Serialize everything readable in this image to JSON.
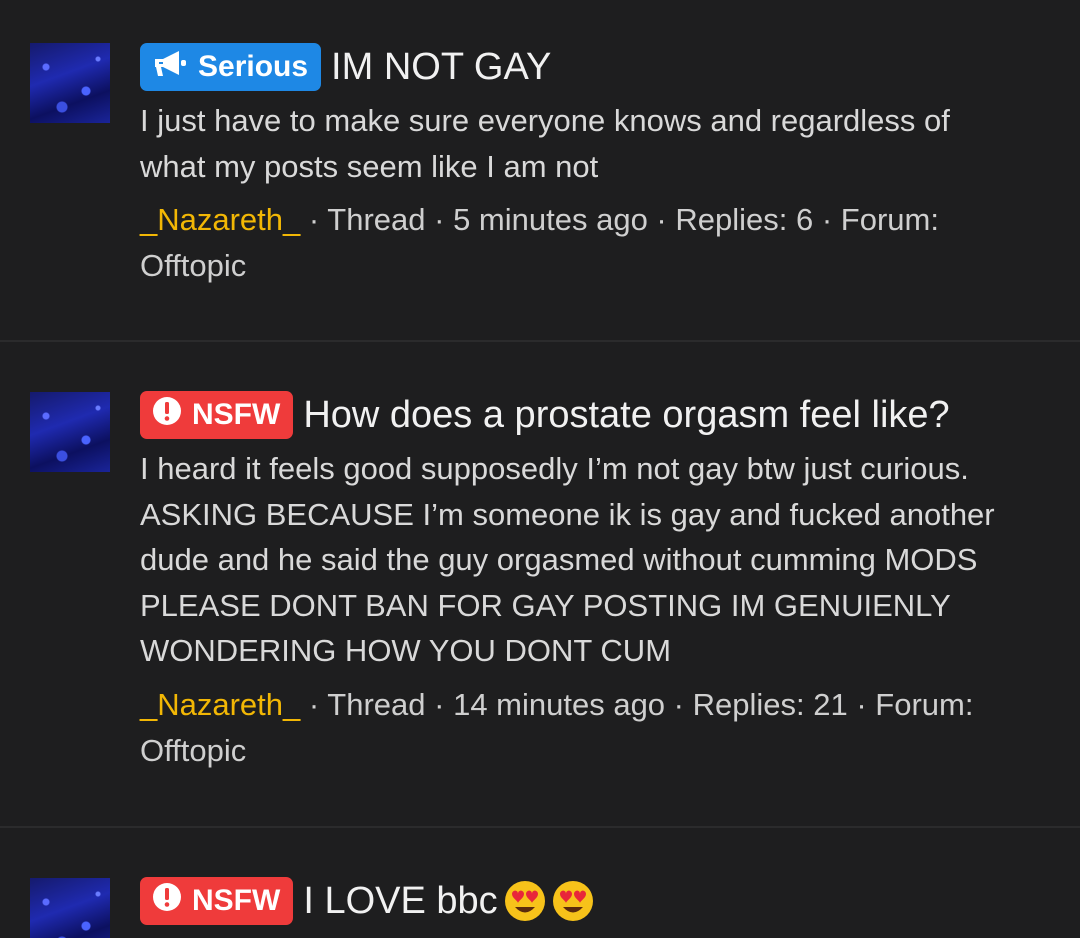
{
  "threads": [
    {
      "prefix": {
        "label": "Serious",
        "type": "serious",
        "color": "#1e88e5",
        "icon": "megaphone-icon"
      },
      "title": "IM NOT GAY",
      "snippet_lines": [
        "I just have to make sure everyone knows and regardless of",
        "what my posts seem like I am not"
      ],
      "author": "_Nazareth_",
      "type": "Thread",
      "time": "5 minutes ago",
      "replies": "Replies: 6",
      "forum_line1": "Forum:",
      "forum_name": "Offtopic"
    },
    {
      "prefix": {
        "label": "NSFW",
        "type": "nsfw",
        "color": "#ef3b3b",
        "icon": "exclamation-circle-icon"
      },
      "title": "How does a prostate orgasm feel like?",
      "snippet_lines": [
        "I heard it feels good supposedly I’m not gay btw just curious.",
        "ASKING BECAUSE I’m someone ik is gay and fucked another",
        "dude and he said the guy orgasmed without cumming MODS",
        "PLEASE DONT BAN FOR GAY POSTING IM GENUIENLY",
        "WONDERING HOW YOU DONT CUM"
      ],
      "author": "_Nazareth_",
      "type": "Thread",
      "time": "14 minutes ago",
      "replies": "Replies: 21",
      "forum_line1": "Forum:",
      "forum_name": "Offtopic"
    },
    {
      "prefix": {
        "label": "NSFW",
        "type": "nsfw",
        "color": "#ef3b3b",
        "icon": "exclamation-circle-icon"
      },
      "title": "I LOVE bbc",
      "title_emojis": [
        "heart-eyes-emoji",
        "heart-eyes-emoji"
      ]
    }
  ],
  "separator": " · "
}
